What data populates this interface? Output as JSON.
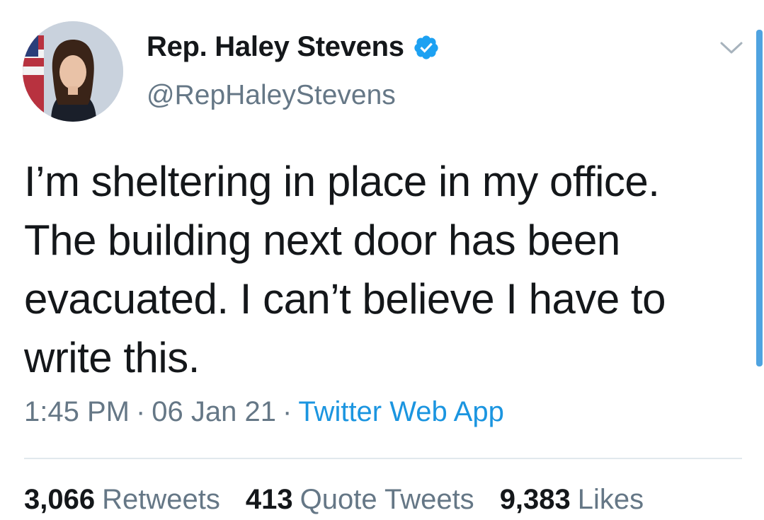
{
  "tweet": {
    "author": {
      "display_name": "Rep. Haley Stevens",
      "handle": "@RepHaleyStevens",
      "verified": true,
      "avatar_icon": "profile-photo"
    },
    "text_lines": [
      "I’m sheltering in place in my office.",
      "The building next door has been",
      "evacuated. I can’t believe I have to",
      "write this."
    ],
    "time": "1:45 PM",
    "separator": "·",
    "date": "06 Jan 21",
    "source": "Twitter Web App",
    "stats": {
      "retweets_count": "3,066",
      "retweets_label": "Retweets",
      "quotes_count": "413",
      "quotes_label": "Quote Tweets",
      "likes_count": "9,383",
      "likes_label": "Likes"
    }
  },
  "colors": {
    "text": "#14171a",
    "secondary": "#657786",
    "link": "#1b95e0",
    "verified": "#1da1f2",
    "divider": "#e1e8ed"
  },
  "icons": {
    "verified": "verified-badge-icon",
    "menu": "chevron-down-icon"
  }
}
